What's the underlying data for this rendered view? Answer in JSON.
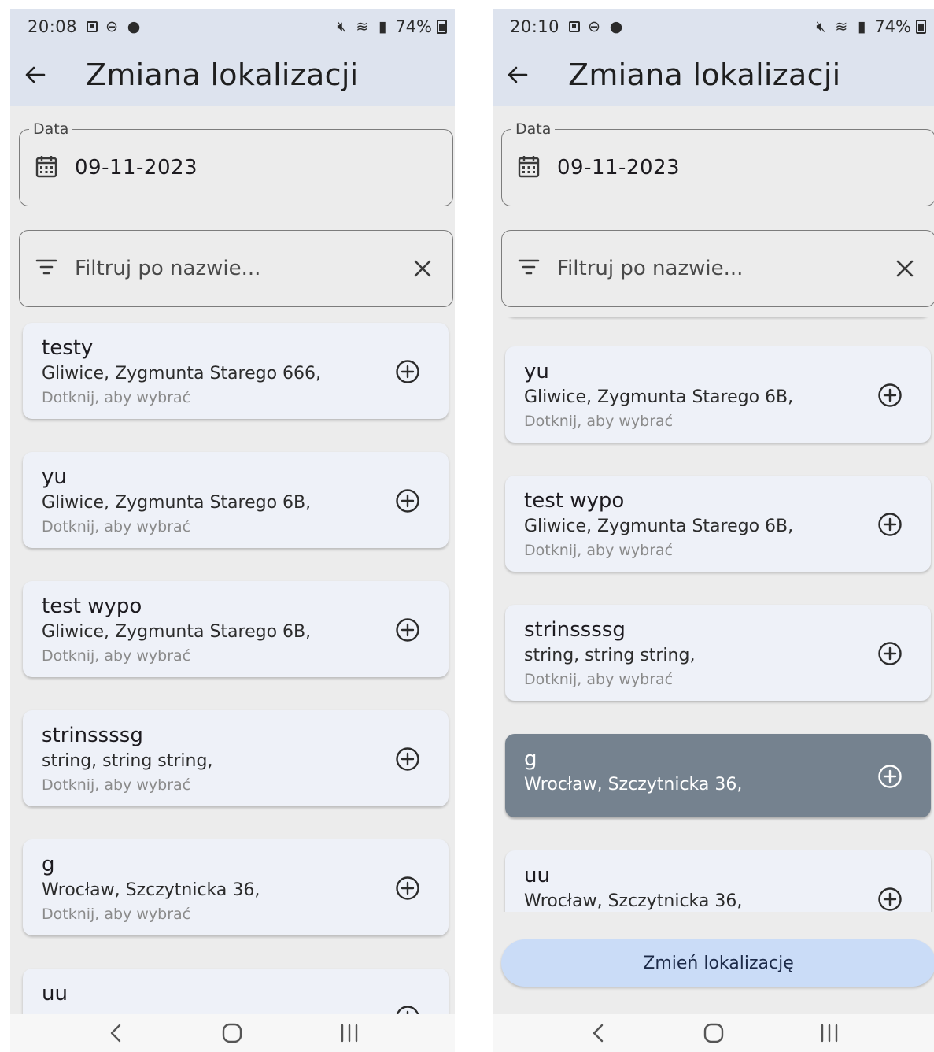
{
  "left": {
    "status": {
      "time": "20:08",
      "battery": "74%"
    },
    "title": "Zmiana lokalizacji",
    "date_label": "Data",
    "date_value": "09-11-2023",
    "filter_placeholder": "Filtruj po nazwie...",
    "items": [
      {
        "name": "testy",
        "address": "Gliwice, Zygmunta Starego 666,",
        "hint": "Dotknij, aby wybrać"
      },
      {
        "name": "yu",
        "address": "Gliwice, Zygmunta Starego 6B,",
        "hint": "Dotknij, aby wybrać"
      },
      {
        "name": "test wypo",
        "address": "Gliwice, Zygmunta Starego 6B,",
        "hint": "Dotknij, aby wybrać"
      },
      {
        "name": "strinssssg",
        "address": "string, string string,",
        "hint": "Dotknij, aby wybrać"
      },
      {
        "name": "g",
        "address": "Wrocław, Szczytnicka 36,",
        "hint": "Dotknij, aby wybrać"
      },
      {
        "name": "uu"
      }
    ]
  },
  "right": {
    "status": {
      "time": "20:10",
      "battery": "74%"
    },
    "title": "Zmiana lokalizacji",
    "date_label": "Data",
    "date_value": "09-11-2023",
    "filter_placeholder": "Filtruj po nazwie...",
    "items": [
      {
        "name": "yu",
        "address": "Gliwice, Zygmunta Starego 6B,",
        "hint": "Dotknij, aby wybrać"
      },
      {
        "name": "test wypo",
        "address": "Gliwice, Zygmunta Starego 6B,",
        "hint": "Dotknij, aby wybrać"
      },
      {
        "name": "strinssssg",
        "address": "string, string string,",
        "hint": "Dotknij, aby wybrać"
      },
      {
        "name": "g",
        "address": "Wrocław, Szczytnicka 36,",
        "selected": true
      },
      {
        "name": "uu",
        "address": "Wrocław, Szczytnicka 36,"
      }
    ],
    "change_button": "Zmień lokalizację"
  },
  "icons": {
    "back": "arrow-back-icon",
    "calendar": "calendar-icon",
    "filter": "filter-icon",
    "clear": "close-icon",
    "add": "add-circle-icon",
    "nav_back": "nav-back-icon",
    "nav_home": "nav-home-icon",
    "nav_recents": "nav-recents-icon"
  },
  "colors": {
    "app_bar": "#dde3ee",
    "background": "#ececec",
    "card": "#eef1f8",
    "card_selected": "#75828f",
    "button": "#cadcf7"
  }
}
